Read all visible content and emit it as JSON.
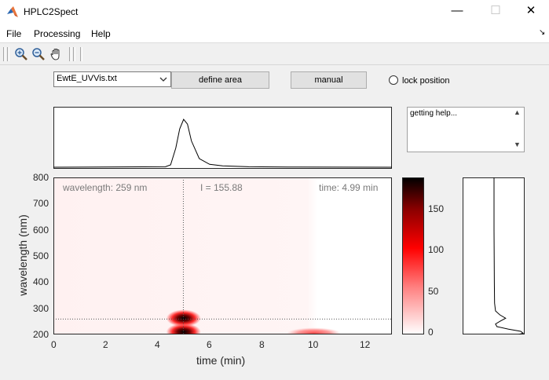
{
  "window": {
    "title": "HPLC2Spect",
    "minimize": "—",
    "maximize": "☐",
    "close": "✕"
  },
  "menu": {
    "file": "File",
    "processing": "Processing",
    "help": "Help",
    "dock": "↘"
  },
  "toolbar": {
    "icons": [
      "zoom-in-icon",
      "zoom-out-icon",
      "pan-hand-icon"
    ]
  },
  "controls": {
    "file_select_value": "EwtE_UVVis.txt",
    "define_area_label": "define area",
    "manual_label": "manual",
    "lock_position_label": "lock position",
    "lock_position_checked": false
  },
  "help_text": "getting help...",
  "heatmap": {
    "annotation_wavelength": "wavelength: 259 nm",
    "annotation_intensity": "I = 155.88",
    "annotation_time": "time: 4.99 min",
    "x_label": "time (min)",
    "y_label": "wavelength (nm)",
    "x_ticks": [
      "0",
      "2",
      "4",
      "6",
      "8",
      "10",
      "12"
    ],
    "y_ticks": [
      "800",
      "700",
      "600",
      "500",
      "400",
      "300",
      "200"
    ]
  },
  "colorbar": {
    "ticks": [
      "150",
      "100",
      "50",
      "0"
    ]
  },
  "chart_data": {
    "type": "heatmap",
    "xlabel": "time (min)",
    "ylabel": "wavelength (nm)",
    "xlim": [
      0,
      13
    ],
    "ylim": [
      200,
      800
    ],
    "cursor": {
      "time": 4.99,
      "wavelength": 259,
      "intensity": 155.88
    },
    "colorbar_range": [
      0,
      185
    ],
    "peaks": [
      {
        "time": 5.0,
        "wavelength": 262,
        "intensity": 185
      },
      {
        "time": 5.0,
        "wavelength": 210,
        "intensity": 185
      },
      {
        "time": 10.0,
        "wavelength": 205,
        "intensity": 60
      }
    ],
    "chromatogram": {
      "x": [
        0,
        4.3,
        4.5,
        4.7,
        4.85,
        5.0,
        5.15,
        5.3,
        5.6,
        6.0,
        6.5,
        7.5,
        9,
        13
      ],
      "y": [
        0,
        0.01,
        0.05,
        0.4,
        0.8,
        1.0,
        0.9,
        0.55,
        0.18,
        0.06,
        0.03,
        0.01,
        0.005,
        0.0
      ]
    },
    "spectrum": {
      "wavelength": [
        800,
        600,
        400,
        320,
        290,
        275,
        262,
        250,
        240,
        230,
        220,
        212,
        205,
        200
      ],
      "intensity": [
        0,
        0,
        0.01,
        0.02,
        0.05,
        0.2,
        0.4,
        0.2,
        0.05,
        0.1,
        0.5,
        0.92,
        1.0,
        0.85
      ]
    }
  }
}
